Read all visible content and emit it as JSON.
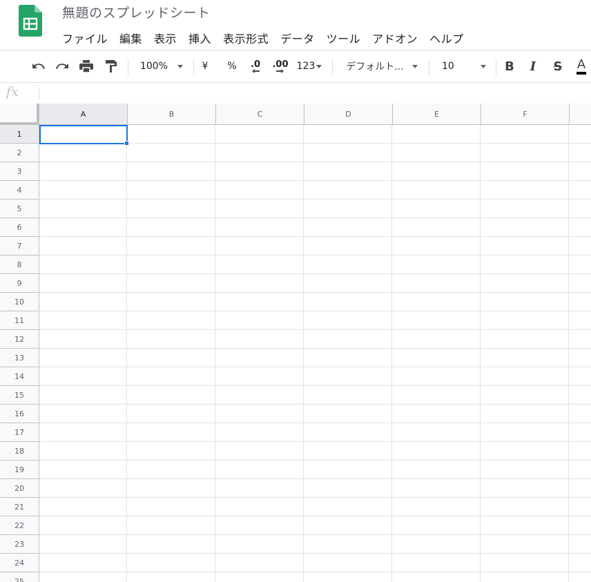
{
  "app": {
    "title": "無題のスプレッドシート",
    "accent_color": "#1e8e3e"
  },
  "menu": [
    "ファイル",
    "編集",
    "表示",
    "挿入",
    "表示形式",
    "データ",
    "ツール",
    "アドオン",
    "ヘルプ"
  ],
  "toolbar": {
    "undo_icon": "undo-icon",
    "redo_icon": "redo-icon",
    "print_icon": "print-icon",
    "paint_format_icon": "paint-format-icon",
    "zoom": "100%",
    "currency": "¥",
    "percent": "%",
    "decrease_decimal": ".0",
    "increase_decimal": ".00",
    "more_formats": "123",
    "font": "デフォルト...",
    "font_size": "10",
    "bold": "B",
    "italic": "I",
    "strikethrough": "S",
    "text_color": "A"
  },
  "formula_bar": {
    "label": "fx",
    "value": ""
  },
  "grid": {
    "columns": [
      "A",
      "B",
      "C",
      "D",
      "E",
      "F"
    ],
    "rows": [
      "1",
      "2",
      "3",
      "4",
      "5",
      "6",
      "7",
      "8",
      "9",
      "10",
      "11",
      "12",
      "13",
      "14",
      "15",
      "16",
      "17",
      "18",
      "19",
      "20",
      "21",
      "22",
      "23",
      "24",
      "25"
    ],
    "selected_cell": "A1",
    "selection_color": "#1a73e8"
  }
}
